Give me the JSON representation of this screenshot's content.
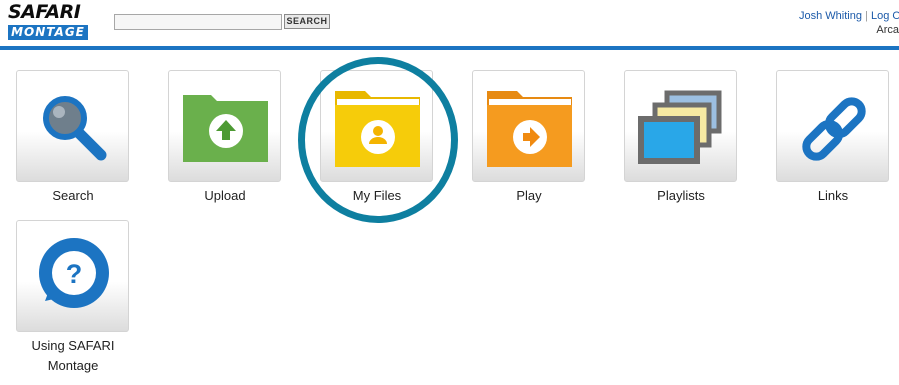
{
  "logo": {
    "line1": "SAFARI",
    "line2": "MONTAGE"
  },
  "search": {
    "placeholder": "",
    "button_label": "SEARCH"
  },
  "user": {
    "name": "Josh Whiting",
    "separator": " | ",
    "logout": "Log O",
    "line2": "Arca"
  },
  "tiles": [
    {
      "label": "Search",
      "icon": "magnifier-icon"
    },
    {
      "label": "Upload",
      "icon": "upload-folder-icon"
    },
    {
      "label": "My Files",
      "icon": "my-files-folder-icon"
    },
    {
      "label": "Play",
      "icon": "play-folder-icon"
    },
    {
      "label": "Playlists",
      "icon": "playlists-icon"
    },
    {
      "label": "Links",
      "icon": "link-icon"
    },
    {
      "label_line1": "Using SAFARI",
      "label_line2": "Montage",
      "icon": "help-bubble-icon"
    }
  ],
  "colors": {
    "brand_blue": "#1c74c2",
    "highlight": "#0e7fa0",
    "upload_green": "#6ab04c",
    "myfiles_yellow": "#f4c400",
    "play_orange": "#f59b1f"
  }
}
